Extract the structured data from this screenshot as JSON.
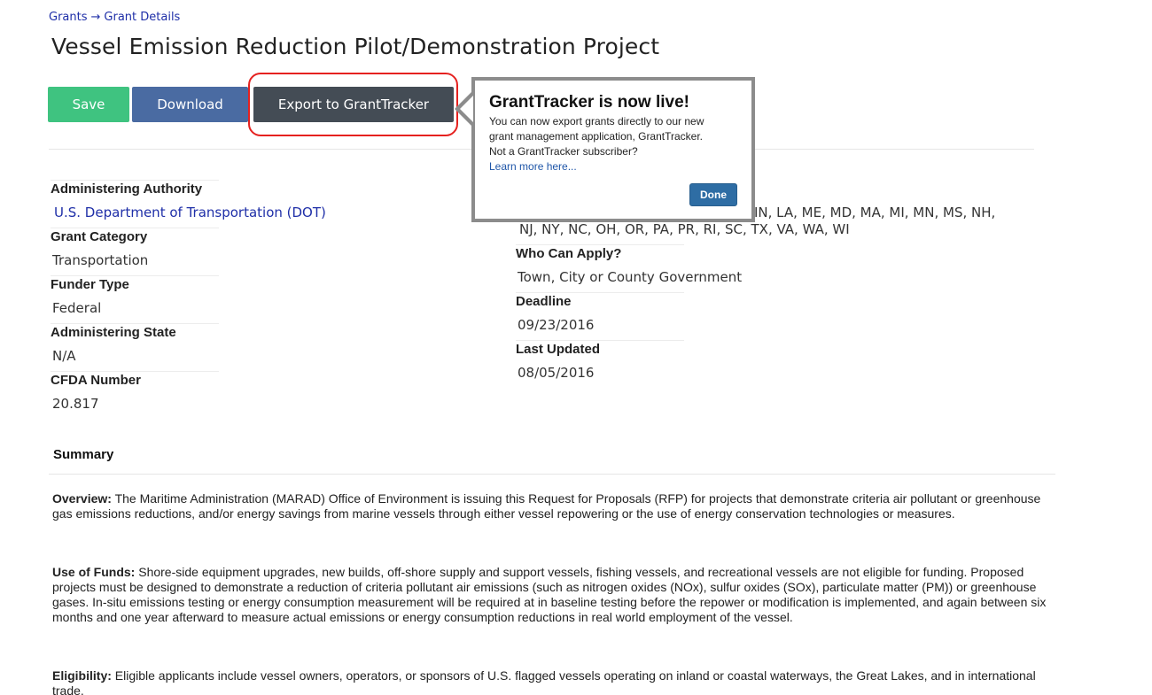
{
  "breadcrumb": {
    "grants": "Grants",
    "separator": "→",
    "current": "Grant Details"
  },
  "page_title": "Vessel Emission Reduction Pilot/Demonstration Project",
  "toolbar": {
    "save_label": "Save",
    "download_label": "Download",
    "export_label": "Export to GrantTracker"
  },
  "left_fields": {
    "administering_authority": {
      "label": "Administering Authority",
      "value": "U.S. Department of Transportation (DOT)"
    },
    "grant_category": {
      "label": "Grant Category",
      "value": "Transportation"
    },
    "funder_type": {
      "label": "Funder Type",
      "value": "Federal"
    },
    "administering_state": {
      "label": "Administering State",
      "value": "N/A"
    },
    "cfda_number": {
      "label": "CFDA Number",
      "value": "20.817"
    }
  },
  "right_fields": {
    "states_line1": "IN, LA, ME, MD, MA, MI, MN, MS, NH,",
    "states_line2": "NJ, NY, NC, OH, OR, PA, PR, RI, SC, TX, VA, WA, WI",
    "who_can_apply": {
      "label": "Who Can Apply?",
      "value": "Town, City or County Government"
    },
    "deadline": {
      "label": "Deadline",
      "value": "09/23/2016"
    },
    "last_updated": {
      "label": "Last Updated",
      "value": "08/05/2016"
    }
  },
  "summary": {
    "label": "Summary",
    "overview": {
      "label": "Overview:",
      "text": "The Maritime Administration (MARAD) Office of Environment is issuing this Request for Proposals (RFP) for projects that demonstrate criteria air pollutant or greenhouse gas emissions reductions, and/or energy savings from marine vessels through either vessel repowering or the use of energy conservation technologies or measures."
    },
    "use_of_funds": {
      "label": "Use of Funds:",
      "text": "Shore-side equipment upgrades, new builds, off-shore supply and support vessels, fishing vessels, and recreational vessels are not eligible for funding. Proposed projects must be designed to demonstrate a reduction of criteria pollutant air emissions (such as nitrogen oxides (NOx), sulfur oxides (SOx), particulate matter (PM)) or greenhouse gases. In-situ emissions testing or energy consumption measurement will be required at in baseline testing before the repower or modification is implemented, and again between six months and one year afterward to measure actual emissions or energy consumption reductions in real world employment of the vessel."
    },
    "eligibility": {
      "label": "Eligibility:",
      "text": "Eligible applicants include vessel owners, operators, or sponsors of U.S. flagged vessels operating on inland or coastal waterways, the Great Lakes, and in international trade."
    }
  },
  "popover": {
    "title": "GrantTracker is now live!",
    "line1": "You can now export grants directly to our new",
    "line2": "grant management application, GrantTracker.",
    "line3": "Not a GrantTracker subscriber?",
    "link": "Learn more here...",
    "done_label": "Done"
  },
  "colors": {
    "save": "#3fc380",
    "download": "#4a6ba2",
    "export": "#444c55",
    "highlight": "#e5211f",
    "link": "#1f2fa8",
    "done": "#2e6da4"
  }
}
